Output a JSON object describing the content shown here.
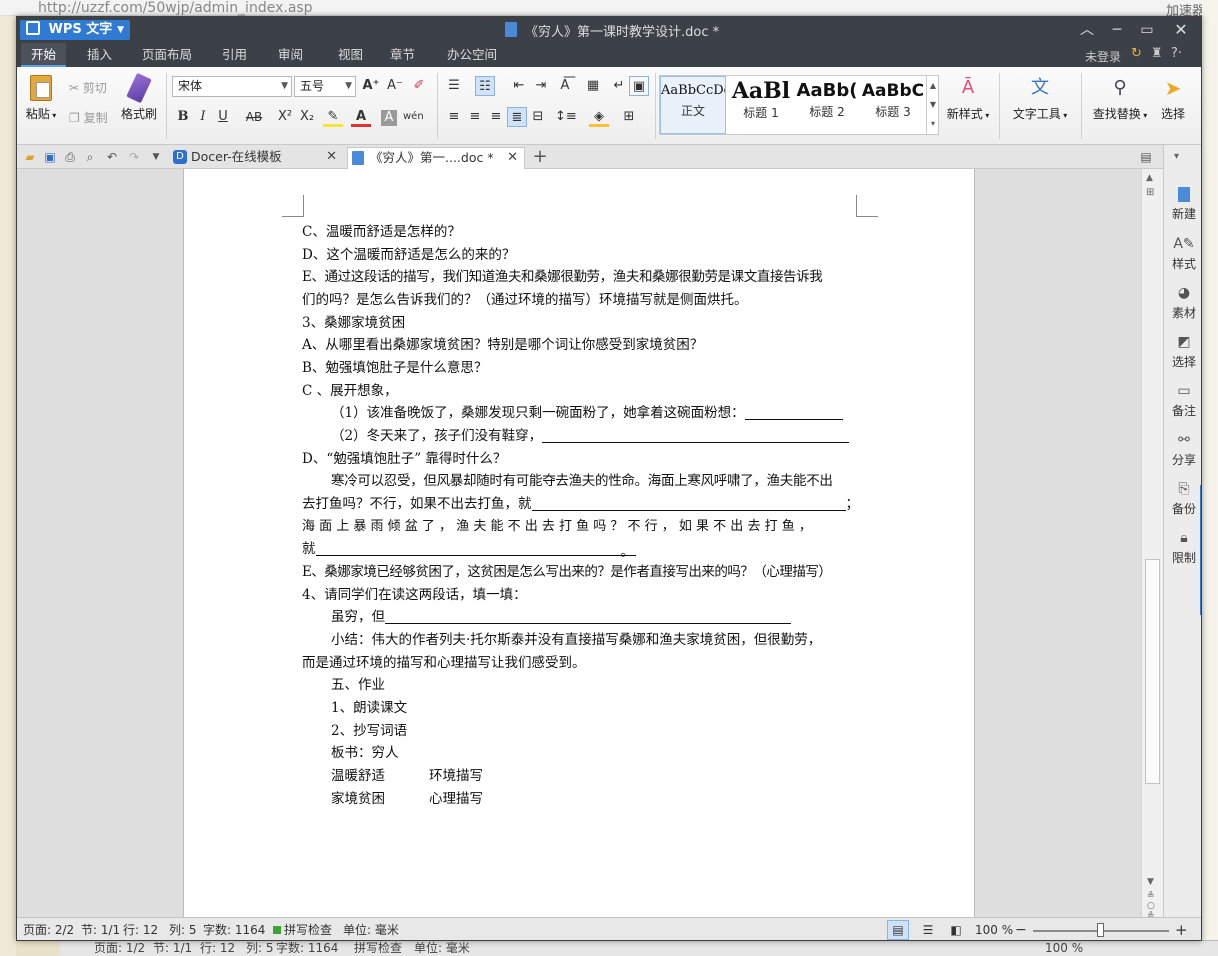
{
  "background": {
    "url": "http://uzzf.com/50wjp/admin_index.asp",
    "right_label": "加速器",
    "status": {
      "page": "页面: 1/2",
      "section": "节: 1/1",
      "row": "行: 12",
      "col": "列: 5",
      "words": "字数: 1164",
      "spell": "拼写检查",
      "unit": "单位: 毫米",
      "zoom": "100 %"
    }
  },
  "app": {
    "name": "WPS 文字",
    "doc_title": "《穷人》第一课时教学设计.doc *"
  },
  "menu": [
    "开始",
    "插入",
    "页面布局",
    "引用",
    "审阅",
    "视图",
    "章节",
    "办公空间"
  ],
  "account": {
    "login": "未登录"
  },
  "ribbon": {
    "paste": "粘贴",
    "cut": "剪切",
    "copy": "复制",
    "format_painter": "格式刷",
    "font_name": "宋体",
    "font_size": "五号",
    "styles": [
      {
        "preview": "AaBbCcDd",
        "label": "正文"
      },
      {
        "preview": "AaBl",
        "label": "标题 1"
      },
      {
        "preview": "AaBb(",
        "label": "标题 2"
      },
      {
        "preview": "AaBbC",
        "label": "标题 3"
      }
    ],
    "new_style": "新样式",
    "text_tool": "文字工具",
    "find_replace": "查找替换",
    "select": "选择"
  },
  "tabs": [
    {
      "label": "Docer-在线模板",
      "active": false
    },
    {
      "label": "《穷人》第一....doc *",
      "active": true
    }
  ],
  "document": {
    "lines": [
      "C、温暖而舒适是怎样的？",
      "D、这个温暖而舒适是怎么的来的？",
      "E、通过这段话的描写，我们知道渔夫和桑娜很勤劳，渔夫和桑娜很勤劳是课文直接告诉我",
      "们的吗？是怎么告诉我们的？（通过环境的描写）环境描写就是侧面烘托。",
      "3、桑娜家境贫困",
      "A、从哪里看出桑娜家境贫困？特别是哪个词让你感受到家境贫困？",
      "B、勉强填饱肚子是什么意思？",
      "C 、展开想象，",
      "（1）该准备晚饭了，桑娜发现只剩一碗面粉了，她拿着这碗面粉想：",
      "（2）冬天来了，孩子们没有鞋穿，",
      "D、“勉强填饱肚子” 靠得时什么？",
      "寒冷可以忍受，但风暴却随时有可能夺去渔夫的性命。海面上寒风呼啸了，渔夫能不出",
      "去打鱼吗？不行，如果不出去打鱼，就",
      "；",
      "海 面 上 暴 雨 倾 盆 了 ， 渔 夫 能 不 出 去 打 鱼 吗 ？ 不 行 ， 如 果 不 出 去 打 鱼 ，",
      "就",
      "。",
      "E、桑娜家境已经够贫困了，这贫困是怎么写出来的？是作者直接写出来的吗？（心理描写）",
      "4、请同学们在读这两段话，填一填：",
      "虽穷，但",
      "小结：伟大的作者列夫·托尔斯泰并没有直接描写桑娜和渔夫家境贫困，但很勤劳，",
      "而是通过环境的描写和心理描写让我们感受到。",
      "五、作业",
      "1、朗读课文",
      "2、抄写词语",
      "板书：穷人",
      "温暖舒适",
      "环境描写",
      "家境贫困",
      "心理描写"
    ]
  },
  "sidepanel": [
    "新建",
    "样式",
    "素材",
    "选择",
    "备注",
    "分享",
    "备份",
    "限制"
  ],
  "status": {
    "page": "页面: 2/2",
    "section": "节: 1/1",
    "row": "行: 12",
    "col": "列: 5",
    "words": "字数: 1164",
    "spell": "拼写检查",
    "unit": "单位: 毫米",
    "zoom": "100 %",
    "zoom_fraction": 0.5
  },
  "colors": {
    "titlebar": "#3c4047",
    "accent": "#2f7bd3",
    "page": "#ffffff"
  }
}
